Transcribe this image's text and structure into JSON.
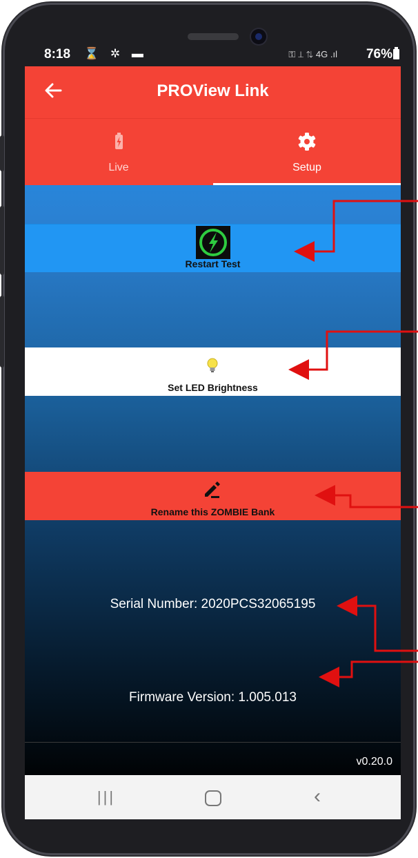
{
  "status_bar": {
    "time": "8:18",
    "battery_percent": "76%",
    "left_icons": "⌛ ✲ ▬",
    "right_icons": "⚿ ⟂ ⇅ 4G .ıl"
  },
  "app_bar": {
    "title": "PROView Link",
    "back_icon": "arrow-back-icon"
  },
  "tabs": [
    {
      "label": "Live",
      "icon": "battery-charging-icon",
      "selected": false
    },
    {
      "label": "Setup",
      "icon": "gear-icon",
      "selected": true
    }
  ],
  "actions": {
    "restart_test": {
      "label": "Restart Test",
      "icon": "restart-power-icon"
    },
    "led_brightness": {
      "label": "Set LED Brightness",
      "icon": "lightbulb-icon"
    },
    "rename_bank": {
      "label": "Rename this ZOMBIE Bank",
      "icon": "pencil-icon"
    }
  },
  "info": {
    "serial_number": "Serial Number: 2020PCS32065195",
    "firmware_version": "Firmware Version: 1.005.013"
  },
  "footer": {
    "app_version": "v0.20.0"
  },
  "nav_bar": {
    "recent_glyph": "|||",
    "back_glyph": "‹"
  },
  "colors": {
    "primary_red": "#f44336",
    "blue": "#2196f3",
    "annotation_arrow": "#e01010"
  }
}
